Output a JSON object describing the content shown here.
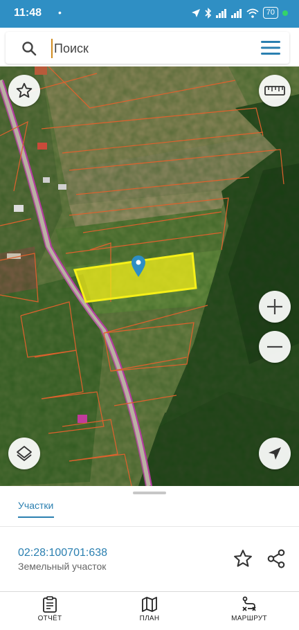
{
  "status_bar": {
    "time": "11:48",
    "dot": "•",
    "battery": "70",
    "icons": [
      "location-icon",
      "bluetooth-icon",
      "signal-icon",
      "signal-icon",
      "wifi-icon",
      "battery-icon"
    ]
  },
  "search": {
    "placeholder": "Поиск",
    "value": ""
  },
  "map": {
    "selected_parcel_color": "#f6f018",
    "parcel_border_color": "#e0612d",
    "road_color": "#b43ca0",
    "pin_color": "#2d8ec4",
    "controls": [
      "star-icon",
      "ruler-icon",
      "zoom-in-icon",
      "zoom-out-icon",
      "layers-icon",
      "navigate-icon"
    ]
  },
  "sheet": {
    "tab_label": "Участки",
    "parcel_number": "02:28:100701:638",
    "parcel_type": "Земельный участок"
  },
  "nav": {
    "report": "ОТЧЁТ",
    "plan": "ПЛАН",
    "route": "МАРШРУТ"
  }
}
